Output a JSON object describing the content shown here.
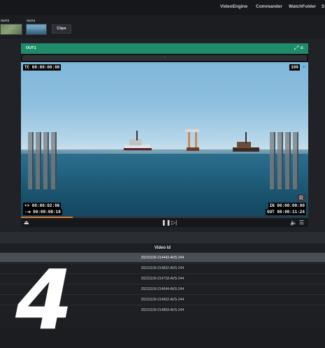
{
  "top_nav": {
    "items": [
      "VideoEngine",
      "Commander",
      "WatchFolder",
      "S"
    ]
  },
  "outputs": [
    {
      "label": "OUT3"
    },
    {
      "label": "OUT4"
    }
  ],
  "clips_button": "Clips",
  "player": {
    "title": "OUT1",
    "strip_text": "-",
    "timecode": "TC 00:00:00:00",
    "volume_readout": "100",
    "in_offset": "+> 00:00:02:06",
    "duration": "-⇥ 00:00:09:18",
    "in_point": "IN 00:00:00:00",
    "out_point": "OUT 00:00:11:24",
    "record_badge": "R",
    "progress": 0.18,
    "icons": {
      "eject": "eject-icon",
      "pause": "pause-icon",
      "step": "step-forward-icon",
      "volume": "volume-icon",
      "settings": "sliders-icon",
      "expand": "expand-icon",
      "menu": "menu-icon"
    }
  },
  "table": {
    "column_header": "Video Id",
    "rows": [
      "20231109-214443-AVS-244",
      "20231109-214832-AVS-244",
      "20231109-214718-AVS-244",
      "20231109-214644-AVS-244",
      "20231109-214602-AVS-244",
      "20231109-214859-AVS-244"
    ],
    "selected_index": 0
  },
  "overlay_number": "4",
  "colors": {
    "header_green": "#1f8b6b",
    "progress_orange": "#e07a2f",
    "background": "#1b1d21"
  }
}
